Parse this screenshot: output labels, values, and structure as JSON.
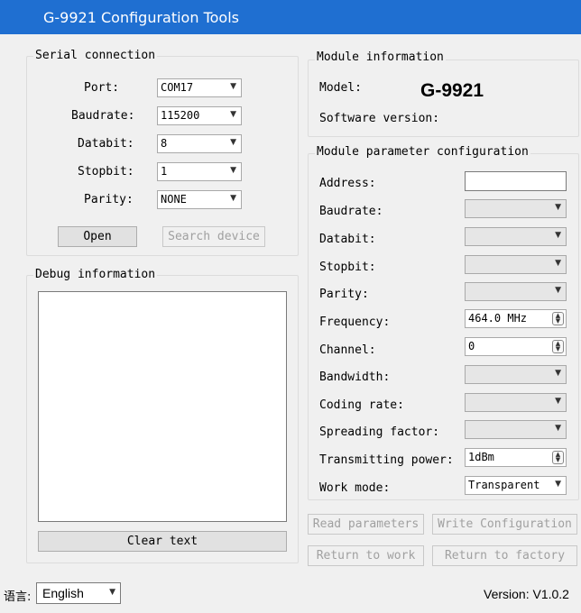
{
  "window": {
    "title": "G-9921 Configuration Tools"
  },
  "serial": {
    "legend": "Serial connection",
    "port_label": "Port:",
    "port_value": "COM17",
    "baud_label": "Baudrate:",
    "baud_value": "115200",
    "databit_label": "Databit:",
    "databit_value": "8",
    "stopbit_label": "Stopbit:",
    "stopbit_value": "1",
    "parity_label": "Parity:",
    "parity_value": "NONE",
    "open_label": "Open",
    "search_label": "Search device"
  },
  "debug": {
    "legend": "Debug information",
    "clear_label": "Clear text"
  },
  "module_info": {
    "legend": "Module information",
    "model_label": "Model:",
    "model_value": "G-9921",
    "sw_label": "Software version:"
  },
  "params": {
    "legend": "Module parameter configuration",
    "address_label": "Address:",
    "baudrate_label": "Baudrate:",
    "databit_label": "Databit:",
    "stopbit_label": "Stopbit:",
    "parity_label": "Parity:",
    "frequency_label": "Frequency:",
    "frequency_value": "464.0 MHz",
    "channel_label": "Channel:",
    "channel_value": "0",
    "bandwidth_label": "Bandwidth:",
    "coding_label": "Coding rate:",
    "spreading_label": "Spreading factor:",
    "power_label": "Transmitting power:",
    "power_value": "1dBm",
    "workmode_label": "Work mode:",
    "workmode_value": "Transparent"
  },
  "actions": {
    "read_label": "Read parameters",
    "write_label": "Write Configuration",
    "return_work_label": "Return to work",
    "return_factory_label": "Return to factory"
  },
  "footer": {
    "language_label": "语言:",
    "language_value": "English",
    "version": "Version: V1.0.2"
  },
  "icons": {
    "dropdown": "chevron-down-icon",
    "spin": "spin-arrows-icon"
  },
  "colors": {
    "titlebar": "#1f6fd1",
    "window": "#f0f0f0"
  }
}
